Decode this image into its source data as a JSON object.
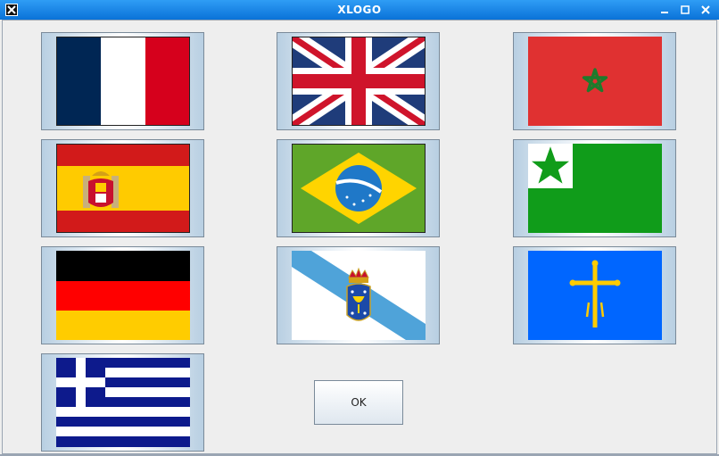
{
  "window": {
    "title": "XLOGO",
    "app_icon": "xlogo-app-icon",
    "controls": [
      "minimize-icon",
      "maximize-icon",
      "close-icon"
    ]
  },
  "dialog": {
    "flag_buttons": [
      {
        "flag": "france",
        "icon": "flag-france-icon"
      },
      {
        "flag": "united-kingdom",
        "icon": "flag-uk-icon"
      },
      {
        "flag": "morocco",
        "icon": "flag-morocco-icon"
      },
      {
        "flag": "spain",
        "icon": "flag-spain-icon"
      },
      {
        "flag": "brazil",
        "icon": "flag-brazil-icon"
      },
      {
        "flag": "esperanto",
        "icon": "flag-esperanto-icon"
      },
      {
        "flag": "germany",
        "icon": "flag-germany-icon"
      },
      {
        "flag": "galicia",
        "icon": "flag-galicia-icon"
      },
      {
        "flag": "asturias",
        "icon": "flag-asturias-icon"
      },
      {
        "flag": "greece",
        "icon": "flag-greece-icon"
      }
    ],
    "ok_label": "OK"
  },
  "colors": {
    "titlebar_top": "#2f9df5",
    "titlebar_bottom": "#0a72d8",
    "background": "#eeeeee"
  }
}
